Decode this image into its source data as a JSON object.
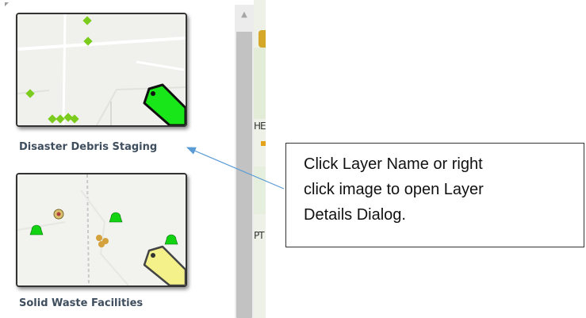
{
  "layers": [
    {
      "name": "Disaster Debris Staging",
      "tag_color": "#19e619"
    },
    {
      "name": "Solid Waste Facilities",
      "tag_color": "#f4f08a"
    }
  ],
  "map_strip": {
    "text_top": "HE",
    "text_bottom": "PT"
  },
  "callout": {
    "lines": [
      "Click Layer Name or right",
      "click image to open Layer",
      "Details Dialog."
    ]
  },
  "colors": {
    "marker_green": "#7ccc1e",
    "facility_green": "#12d312",
    "arrow": "#5b9bd5"
  }
}
